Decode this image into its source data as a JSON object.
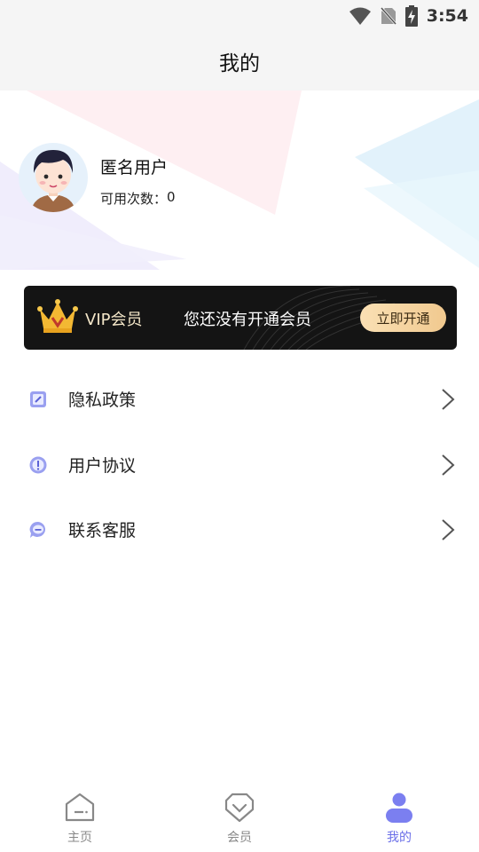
{
  "status_bar": {
    "time": "3:54",
    "icons": [
      "wifi-icon",
      "no-sim-icon",
      "battery-charging-icon"
    ]
  },
  "header": {
    "title": "我的"
  },
  "profile": {
    "name": "匿名用户",
    "usage_label": "可用次数：",
    "usage_count": "0",
    "avatar_icon": "avatar-boy-icon"
  },
  "vip": {
    "crown_icon": "crown-icon",
    "label": "VIP会员",
    "message": "您还没有开通会员",
    "button_label": "立即开通",
    "colors": {
      "banner_bg": "#141414",
      "button_from": "#fae0b4",
      "button_to": "#f1c98f",
      "label": "#f3e6c8"
    }
  },
  "menu": [
    {
      "label": "隐私政策",
      "icon": "document-edit-icon"
    },
    {
      "label": "用户协议",
      "icon": "info-circle-icon"
    },
    {
      "label": "联系客服",
      "icon": "chat-bubble-icon"
    }
  ],
  "bottom_nav": [
    {
      "label": "主页",
      "icon": "home-icon",
      "active": false
    },
    {
      "label": "会员",
      "icon": "vip-diamond-icon",
      "active": false
    },
    {
      "label": "我的",
      "icon": "user-icon",
      "active": true
    }
  ],
  "colors": {
    "accent": "#6b6fe8",
    "icon_tint": "#7b83e8",
    "header_bg": "#f5f5f5"
  }
}
